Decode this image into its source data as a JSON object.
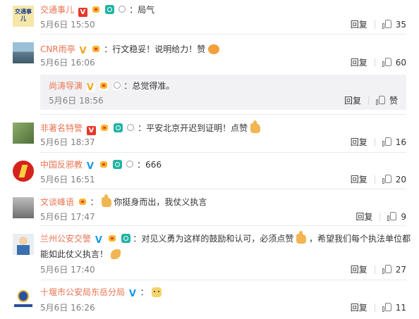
{
  "comments": [
    {
      "name": "交通事儿",
      "badges": [
        "vred",
        "member",
        "cam",
        "medal"
      ],
      "text": "：局气",
      "emoji": null,
      "time": "5月6日 15:50",
      "reply": "回复",
      "like": "35"
    },
    {
      "name": "CNR雨亭",
      "badges": [
        "vgold",
        "member"
      ],
      "text": "：行文稳妥！说明给力！赞",
      "emoji": "clap",
      "time": "5月6日 16:06",
      "reply": "回复",
      "like": "60"
    },
    {
      "name": "非著名特警",
      "badges": [
        "vred",
        "member",
        "cam",
        "medal"
      ],
      "text": "：平安北京开迟到证明！点赞",
      "emoji": "thumb",
      "time": "5月6日 18:37",
      "reply": "回复",
      "like": "16"
    },
    {
      "name": "中国反邪教",
      "badges": [
        "vblue",
        "member",
        "cam",
        "medal"
      ],
      "text": "：666",
      "emoji": null,
      "time": "5月6日 16:51",
      "reply": "回复",
      "like": "20"
    },
    {
      "name": "文谈峰语",
      "badges": [
        "member"
      ],
      "text": "：",
      "emoji": "thumb",
      "text2": "你挺身而出，我仗义执言",
      "time": "5月6日 17:47",
      "reply": "回复",
      "like": "9"
    },
    {
      "name": "兰州公安交警",
      "badges": [
        "vblue",
        "member",
        "cam"
      ],
      "text": "：对见义勇为这样的鼓励和认可，必须点赞",
      "emoji": "thumb",
      "text2": "，希望我们每个执法单位都",
      "line2": "能如此仗义执言！",
      "emoji2": "muscle",
      "time": "5月6日 17:40",
      "reply": "回复",
      "like": "27"
    },
    {
      "name": "十堰市公安局东岳分局",
      "badges": [
        "vblue"
      ],
      "text": "：",
      "emoji": "doge",
      "time": "5月6日 16:26",
      "reply": "回复",
      "like": "11"
    }
  ],
  "subreply": {
    "name": "尚涛导演",
    "badges": [
      "vgold",
      "member",
      "medal"
    ],
    "text": "：总觉得准。",
    "time": "5月6日 18:56",
    "reply": "回复",
    "like": "赞"
  },
  "avatars": {
    "a1": {
      "label": "交通事儿",
      "bg": "#f6e7a8"
    },
    "a2": {
      "bg": "#7aa0b8"
    },
    "a3": {
      "bg": "#6b8a55"
    },
    "a4": {
      "bg": "#d6221c"
    },
    "a5": {
      "bg": "#8f8f8f"
    },
    "a6": {
      "bg": "#e9eef2"
    },
    "a7": {
      "bg": "#2b4fa1"
    }
  }
}
